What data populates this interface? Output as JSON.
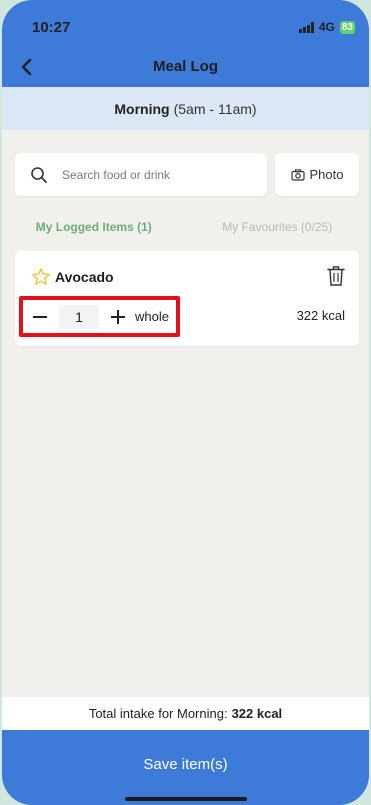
{
  "status_bar": {
    "time": "10:27",
    "network": "4G",
    "battery": "83"
  },
  "header": {
    "title": "Meal Log"
  },
  "period": {
    "name": "Morning",
    "range": "(5am - 11am)"
  },
  "search": {
    "placeholder": "Search food or drink",
    "photo_label": "Photo"
  },
  "tabs": [
    {
      "label": "My Logged Items (1)",
      "active": true
    },
    {
      "label": "My Favourites (0/25)",
      "active": false
    }
  ],
  "items": [
    {
      "name": "Avocado",
      "quantity": "1",
      "unit": "whole",
      "calories": "322 kcal"
    }
  ],
  "total": {
    "label": "Total intake for Morning:",
    "value": "322 kcal"
  },
  "save_button": {
    "label": "Save item(s)"
  },
  "colors": {
    "primary": "#3e7ad7",
    "tab_active": "#6aae7a",
    "highlight": "#e4101e",
    "star": "#f2c230"
  }
}
